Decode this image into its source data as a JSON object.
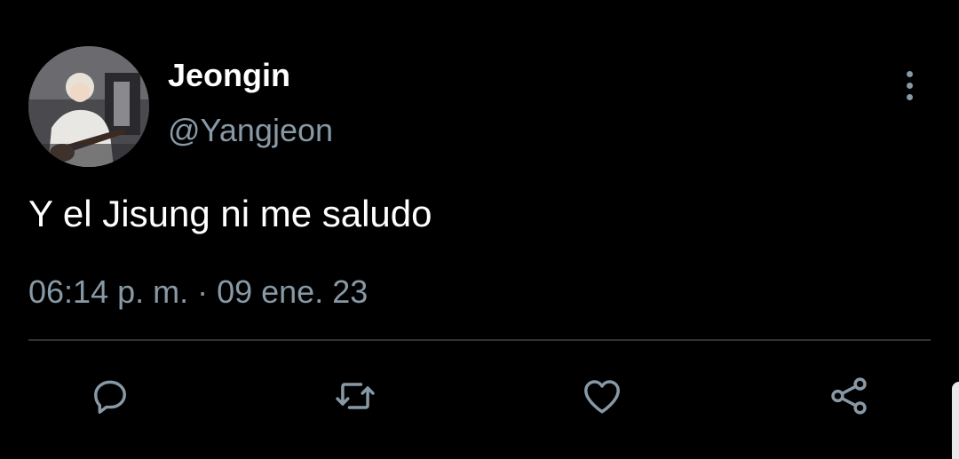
{
  "tweet": {
    "author_name": "Jeongin",
    "author_handle": "@Yangjeon",
    "text": "Y el Jisung ni me saludo",
    "timestamp": "06:14 p. m. · 09 ene. 23"
  },
  "icons": {
    "avatar": "profile-photo",
    "more": "more-vertical-icon",
    "reply": "reply-icon",
    "retweet": "retweet-icon",
    "like": "heart-icon",
    "share": "share-icon"
  },
  "colors": {
    "background": "#000000",
    "primary_text": "#ffffff",
    "secondary_text": "#8899a6",
    "divider": "#2f3336"
  }
}
